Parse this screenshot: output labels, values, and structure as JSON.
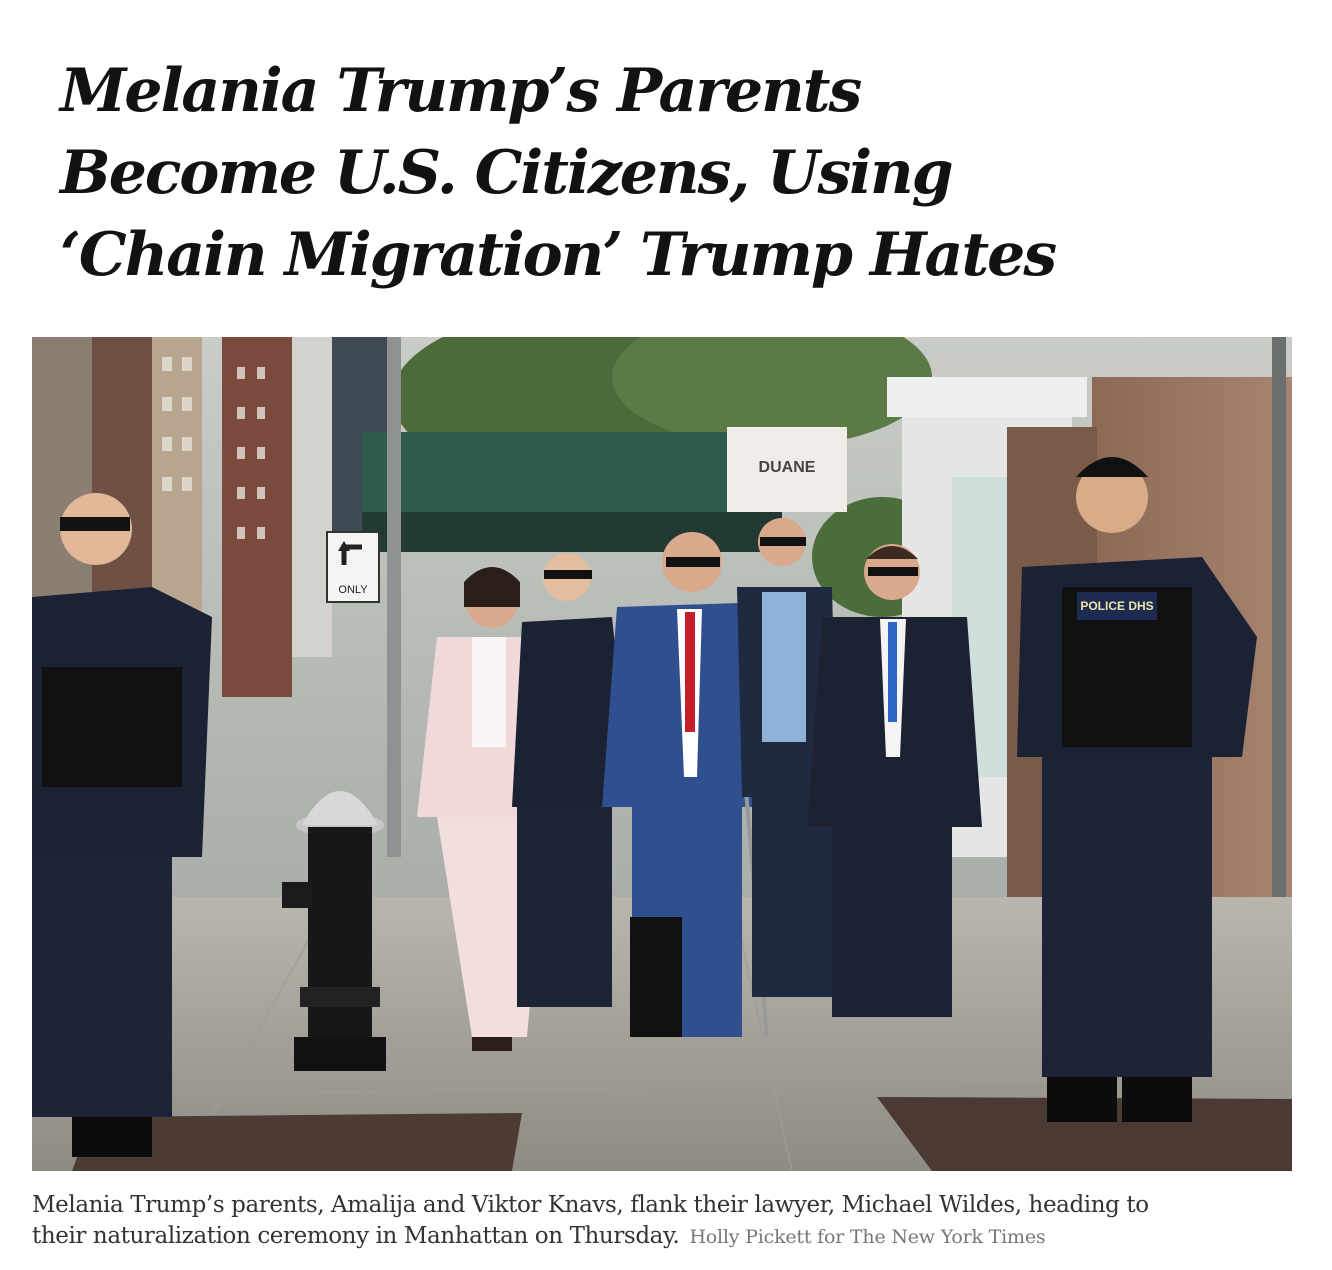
{
  "article": {
    "headline": {
      "line1": "Melania Trump’s Parents",
      "line2": "Become U.S. Citizens, Using",
      "line3": "‘Chain Migration’ Trump Hates"
    },
    "photo": {
      "sign_turn": "ONLY",
      "sign_store": "DUANE",
      "badge_text": "POLICE DHS"
    },
    "caption": {
      "text_line1": "Melania Trump’s parents, Amalija and Viktor Knavs, flank their lawyer, Michael Wildes, heading to",
      "text_line2": "their naturalization ceremony in Manhattan on Thursday.",
      "credit": "Holly Pickett for The New York Times"
    }
  },
  "colors": {
    "headline": "#121212",
    "caption": "#333333",
    "credit": "#777777",
    "uniform": "#1b2233",
    "suit_blue": "#2f4f8f",
    "suit_pink": "#f0d9d8"
  }
}
